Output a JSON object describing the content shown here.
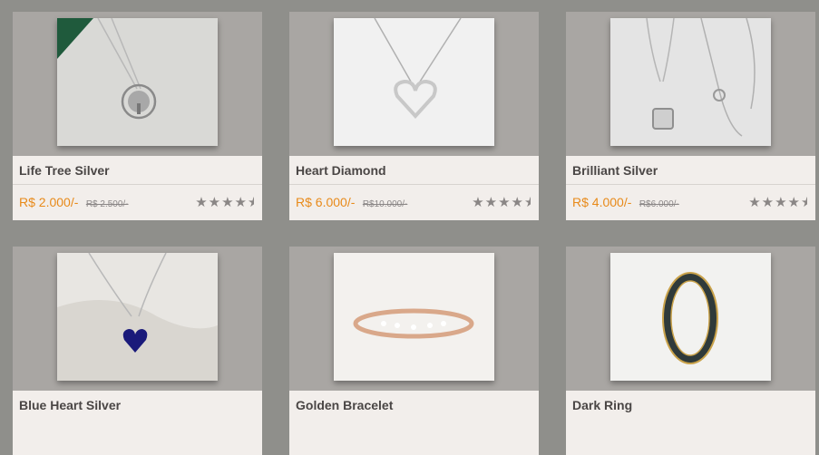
{
  "products": [
    {
      "name": "Life Tree Silver",
      "price": "R$ 2.000/-",
      "old_price": "R$ 2.500/-",
      "rating": 4.5,
      "image": "tree-pendant-necklace-image"
    },
    {
      "name": "Heart Diamond",
      "price": "R$ 6.000/-",
      "old_price": "R$10.000/-",
      "rating": 4.5,
      "image": "heart-pendant-necklace-image"
    },
    {
      "name": "Brilliant Silver",
      "price": "R$ 4.000/-",
      "old_price": "R$6.000/-",
      "rating": 4.5,
      "image": "square-pendant-necklace-image"
    },
    {
      "name": "Blue Heart Silver",
      "price": "",
      "old_price": "",
      "rating": null,
      "image": "blue-heart-necklace-image"
    },
    {
      "name": "Golden Bracelet",
      "price": "",
      "old_price": "",
      "rating": null,
      "image": "rose-gold-ring-image"
    },
    {
      "name": "Dark Ring",
      "price": "",
      "old_price": "",
      "rating": null,
      "image": "dark-ring-image"
    }
  ],
  "colors": {
    "price": "#e88a1a",
    "card_bg": "#a9a6a3",
    "info_bg": "#f2eeeb",
    "page_bg": "#8f8f8b",
    "star": "#8a8685"
  },
  "star_icon": "star-icon"
}
